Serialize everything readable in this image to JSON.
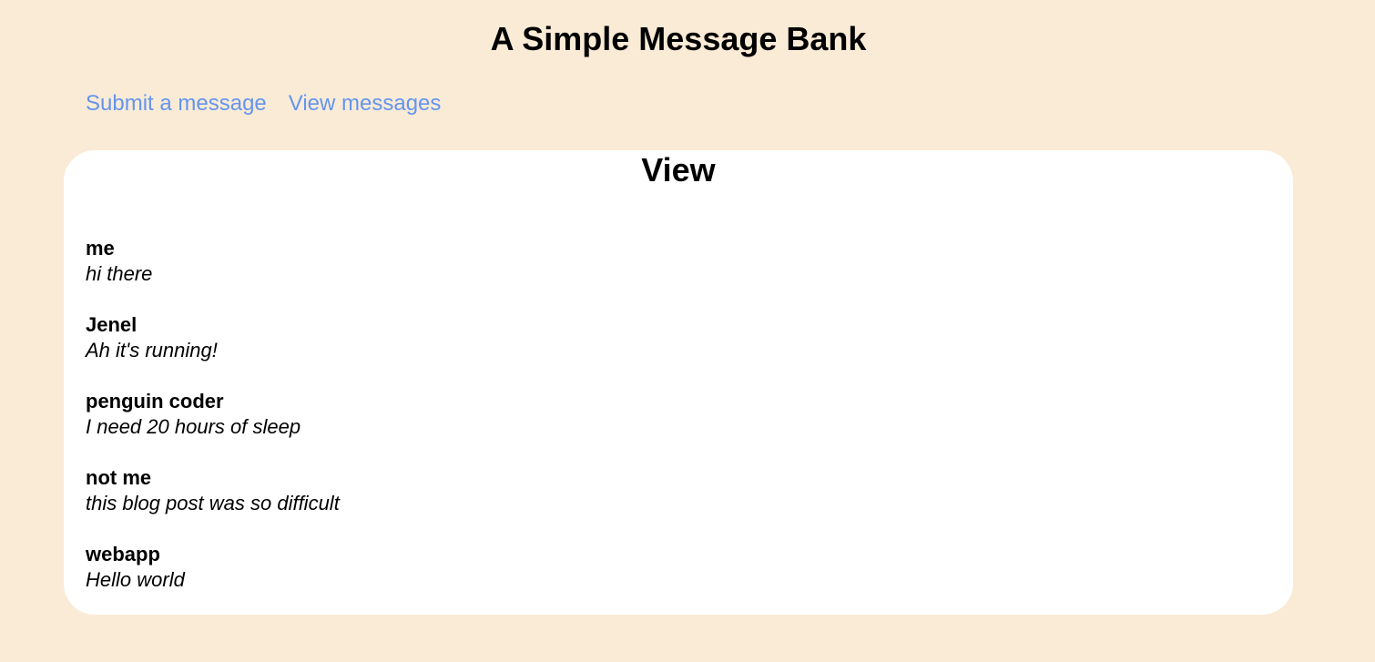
{
  "header": {
    "title": "A Simple Message Bank"
  },
  "nav": {
    "submit_label": "Submit a message",
    "view_label": "View messages"
  },
  "colors": {
    "background": "#FAEBD7",
    "panel": "#FFFFFF",
    "link": "#6495ED"
  },
  "view": {
    "title": "View",
    "messages": [
      {
        "author": "me",
        "text": "hi there"
      },
      {
        "author": "Jenel",
        "text": "Ah it's running!"
      },
      {
        "author": "penguin coder",
        "text": "I need 20 hours of sleep"
      },
      {
        "author": "not me",
        "text": "this blog post was so difficult"
      },
      {
        "author": "webapp",
        "text": "Hello world"
      }
    ]
  }
}
